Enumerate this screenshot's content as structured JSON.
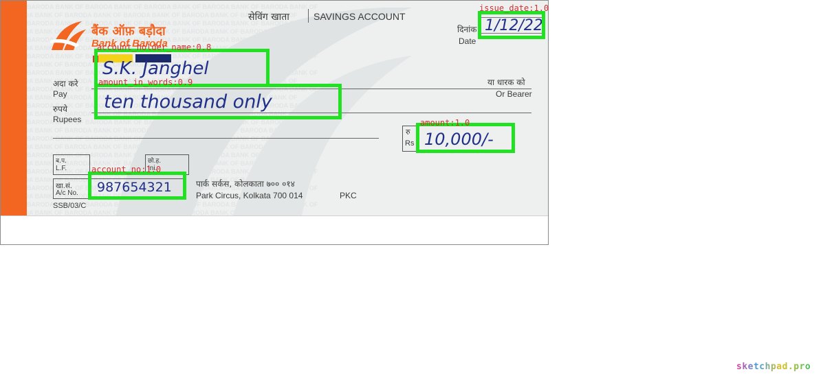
{
  "bank": {
    "name_hindi": "बैंक ऑफ़ बड़ौदा",
    "name_english": "Bank of Baroda",
    "logo_color": "#f26622",
    "pattern_text": "BARODA BANK OF BARODA BANK OF BARODA BANK OF BARODA BANK OF BARODA BANK OF"
  },
  "header": {
    "account_type_hindi": "सेविंग खाता",
    "account_type_english": "SAVINGS ACCOUNT",
    "date_label_hindi": "दिनांक",
    "date_label_english": "Date"
  },
  "pay": {
    "label_hindi": "अदा करे",
    "label_english": "Pay",
    "bearer_hindi": "या धारक को",
    "bearer_english": "Or Bearer"
  },
  "rupees": {
    "label_hindi": "रुपये",
    "label_english": "Rupees"
  },
  "amount_box": {
    "label_hindi": "रु",
    "label_english": "Rs"
  },
  "lf": {
    "bp": "ब.प.",
    "lf": "L.F.",
    "chh": "छो.ह.",
    "in": "Ini."
  },
  "account": {
    "label_hindi": "खा.सं.",
    "label_english": "A/c No."
  },
  "branch": {
    "address_hindi": "पार्क सर्कस, कोलकाता ७०० ०१४",
    "address_english": "Park Circus, Kolkata  700 014",
    "code": "PKC"
  },
  "form_code": "SSB/03/C",
  "handwritten": {
    "issue_date": "1/12/22",
    "account_holder_name": "S.K. Janghel",
    "amount_in_words": "ten thousand only",
    "amount": "10,000/-",
    "account_no": "987654321"
  },
  "detections": [
    {
      "label": "issue_date:1.0"
    },
    {
      "label": "account_holder_name:0.8"
    },
    {
      "label": "amount_in_words:0.9"
    },
    {
      "label": "amount:1.0"
    },
    {
      "label": "account_no:1.0"
    }
  ],
  "watermark": "sketchpad.pro",
  "colors": {
    "detection_box": "#22e022",
    "detection_label": "#d23030",
    "ink": "#1f2f8a"
  }
}
